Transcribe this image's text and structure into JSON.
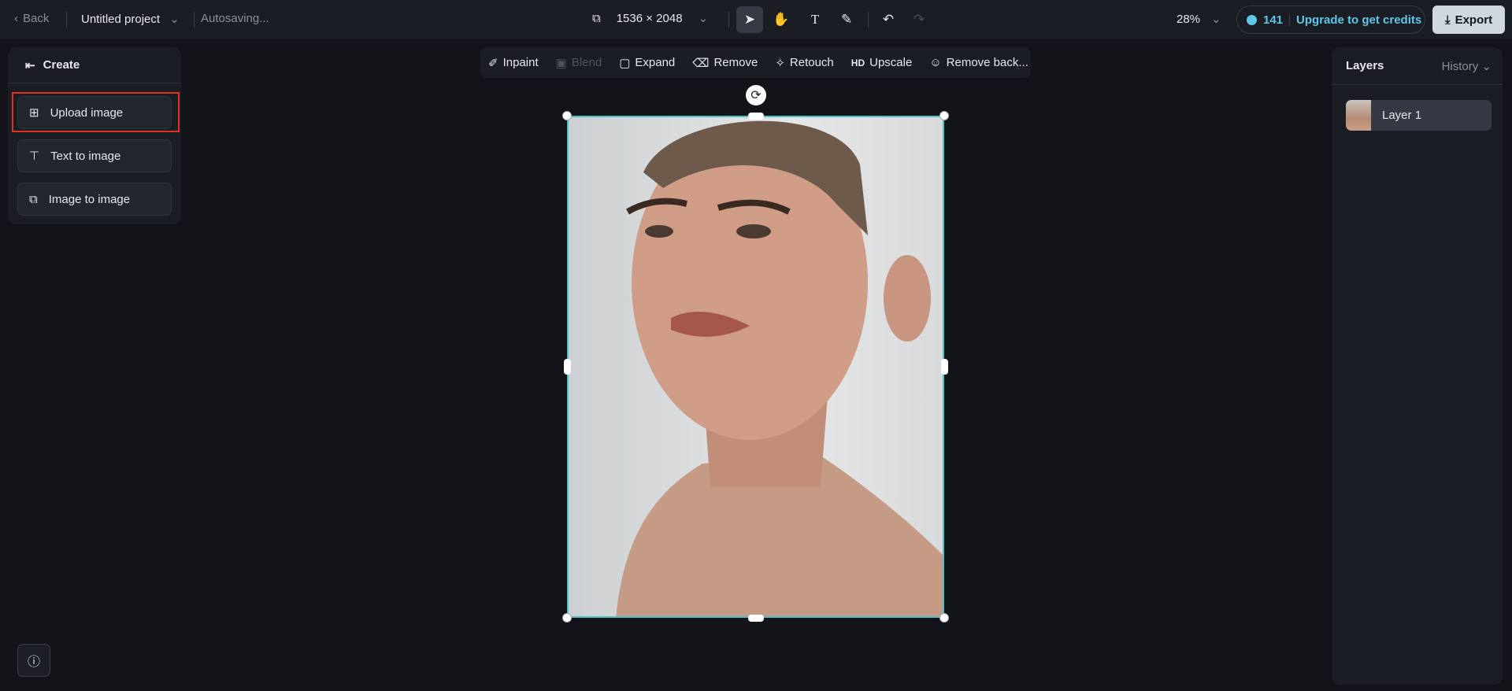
{
  "topbar": {
    "back": "Back",
    "project": "Untitled project",
    "status": "Autosaving...",
    "size": "1536 × 2048",
    "zoom": "28%",
    "credits": "141",
    "upgrade": "Upgrade to get credits",
    "export": "Export"
  },
  "left": {
    "title": "Create",
    "buttons": [
      "Upload image",
      "Text to image",
      "Image to image"
    ]
  },
  "edit_toolbar": [
    "Inpaint",
    "Blend",
    "Expand",
    "Remove",
    "Retouch",
    "Upscale",
    "Remove back..."
  ],
  "edit_hd": "HD",
  "right": {
    "title": "Layers",
    "history": "History",
    "layers": [
      "Layer 1"
    ]
  },
  "colors": {
    "accent": "#4fc1c4",
    "highlight": "#e0321f",
    "upgrade": "#5fc7e8"
  }
}
